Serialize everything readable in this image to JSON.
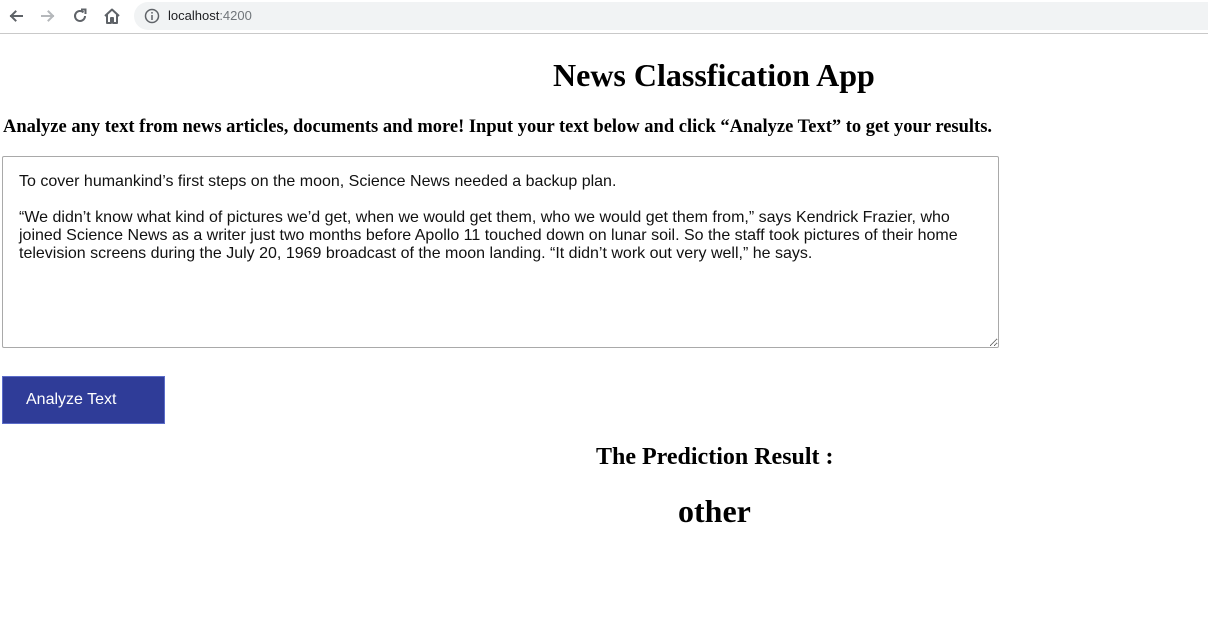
{
  "browser": {
    "url_host": "localhost",
    "url_port": ":4200"
  },
  "page": {
    "title": "News Classfication App",
    "subtitle": "Analyze any text from news articles, documents and more! Input your text below and click “Analyze Text” to get your results.",
    "input_text": "To cover humankind’s first steps on the moon, Science News needed a backup plan.\n\n“We didn’t know what kind of pictures we’d get, when we would get them, who we would get them from,” says Kendrick Frazier, who joined Science News as a writer just two months before Apollo 11 touched down on lunar soil. So the staff took pictures of their home television screens during the July 20, 1969 broadcast of the moon landing. “It didn’t work out very well,” he says.",
    "analyze_button_label": "Analyze Text",
    "result_heading": "The Prediction Result :",
    "result_value": "other"
  },
  "colors": {
    "button_bg": "#2f3c98",
    "button_text": "#ffffff"
  },
  "icons": [
    "back-arrow-icon",
    "forward-arrow-icon",
    "reload-icon",
    "home-icon",
    "info-icon"
  ]
}
